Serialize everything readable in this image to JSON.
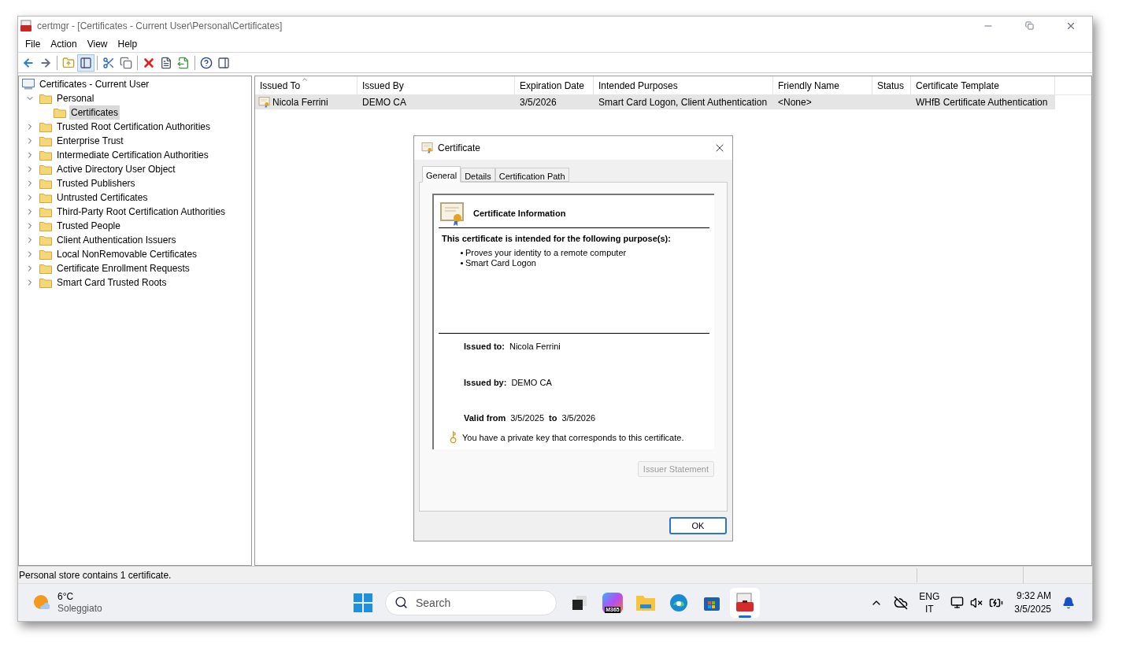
{
  "window": {
    "title": "certmgr - [Certificates - Current User\\Personal\\Certificates]"
  },
  "menu": [
    "File",
    "Action",
    "View",
    "Help"
  ],
  "toolbar": [
    {
      "pressed": false
    },
    {
      "pressed": false
    },
    {
      "pressed": false
    },
    {
      "pressed": true
    },
    {
      "pressed": false
    },
    {
      "pressed": false
    },
    {
      "pressed": false
    },
    {
      "pressed": false
    },
    {
      "pressed": false
    },
    {
      "pressed": false
    },
    {
      "pressed": false
    }
  ],
  "tree": [
    {
      "label": "Certificates - Current User",
      "kind": "store",
      "selected": false,
      "children": [
        {
          "label": "Personal",
          "kind": "folder",
          "expanded": true,
          "selected": false,
          "children": [
            {
              "label": "Certificates",
              "kind": "folder",
              "selected": true
            }
          ]
        },
        {
          "label": "Trusted Root Certification Authorities",
          "kind": "folder",
          "expanded": false,
          "selected": false
        },
        {
          "label": "Enterprise Trust",
          "kind": "folder",
          "expanded": false,
          "selected": false
        },
        {
          "label": "Intermediate Certification Authorities",
          "kind": "folder",
          "expanded": false,
          "selected": false
        },
        {
          "label": "Active Directory User Object",
          "kind": "folder",
          "expanded": false,
          "selected": false
        },
        {
          "label": "Trusted Publishers",
          "kind": "folder",
          "expanded": false,
          "selected": false
        },
        {
          "label": "Untrusted Certificates",
          "kind": "folder",
          "expanded": false,
          "selected": false
        },
        {
          "label": "Third-Party Root Certification Authorities",
          "kind": "folder",
          "expanded": false,
          "selected": false
        },
        {
          "label": "Trusted People",
          "kind": "folder",
          "expanded": false,
          "selected": false
        },
        {
          "label": "Client Authentication Issuers",
          "kind": "folder",
          "expanded": false,
          "selected": false
        },
        {
          "label": "Local NonRemovable Certificates",
          "kind": "folder",
          "expanded": false,
          "selected": false
        },
        {
          "label": "Certificate Enrollment Requests",
          "kind": "folder",
          "expanded": false,
          "selected": false
        },
        {
          "label": "Smart Card Trusted Roots",
          "kind": "folder",
          "expanded": false,
          "selected": false
        }
      ]
    }
  ],
  "table": {
    "columns": [
      {
        "label": "Issued To",
        "sorted": true
      },
      {
        "label": "Issued By",
        "sorted": false
      },
      {
        "label": "Expiration Date",
        "sorted": false
      },
      {
        "label": "Intended Purposes",
        "sorted": false
      },
      {
        "label": "Friendly Name",
        "sorted": false
      },
      {
        "label": "Status",
        "sorted": false
      },
      {
        "label": "Certificate Template",
        "sorted": false
      }
    ],
    "rows": [
      {
        "selected": true,
        "cells": [
          "Nicola Ferrini",
          "DEMO CA",
          "3/5/2026",
          "Smart Card Logon, Client Authentication",
          "<None>",
          "",
          "WHfB Certificate Authentication"
        ]
      }
    ]
  },
  "dialog": {
    "title": "Certificate",
    "tabs": [
      {
        "label": "General",
        "selected": true
      },
      {
        "label": "Details",
        "selected": false
      },
      {
        "label": "Certification Path",
        "selected": false
      }
    ],
    "heading": "Certificate Information",
    "purpose_title": "This certificate is intended for the following purpose(s):",
    "purposes": [
      "Proves your identity to a remote computer",
      "Smart Card Logon"
    ],
    "issued_to": {
      "label": "Issued to:",
      "value": "Nicola Ferrini"
    },
    "issued_by": {
      "label": "Issued by:",
      "value": "DEMO CA"
    },
    "valid": {
      "from_label": "Valid from",
      "from": "3/5/2025",
      "to_label": "to",
      "to": "3/5/2026"
    },
    "key_note": "You have a private key that corresponds to this certificate.",
    "issuer_statement": {
      "label": "Issuer Statement",
      "disabled": true
    },
    "ok": "OK"
  },
  "status_bar": "Personal store contains 1 certificate.",
  "taskbar": {
    "weather": {
      "temp": "6°C",
      "condition": "Soleggiato"
    },
    "search": {
      "placeholder": "Search"
    },
    "apps": [
      {
        "kind": "taskview",
        "active": false
      },
      {
        "kind": "m365",
        "badge": "M365",
        "active": false
      },
      {
        "kind": "explorer",
        "active": false
      },
      {
        "kind": "edge",
        "active": false
      },
      {
        "kind": "store",
        "active": false
      },
      {
        "kind": "certmgr",
        "active": true
      }
    ],
    "language": {
      "top": "ENG",
      "bottom": "IT"
    },
    "time": "9:32 AM",
    "date": "3/5/2025"
  }
}
